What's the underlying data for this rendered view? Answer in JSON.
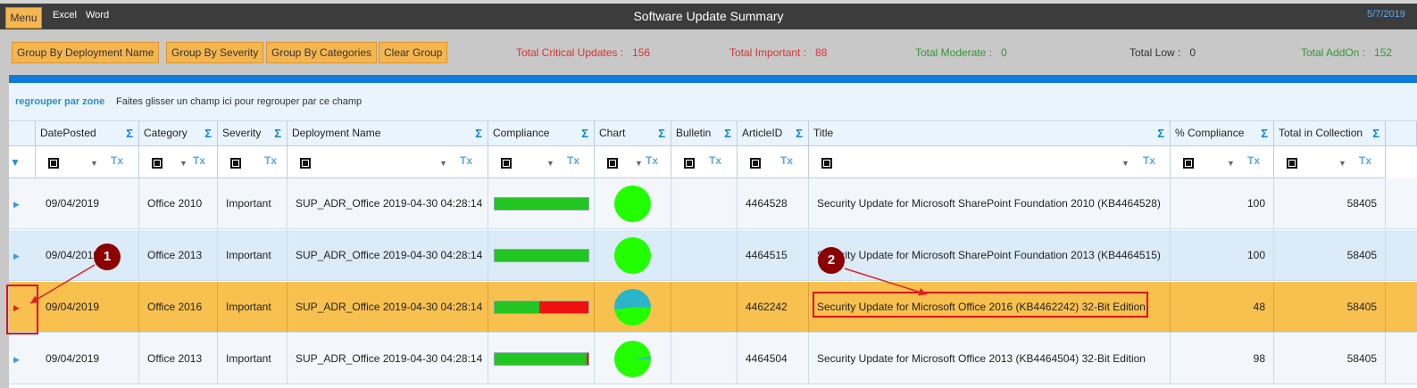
{
  "topbar": {
    "menu": "Menu",
    "excel": "Excel",
    "word": "Word",
    "title": "Software Update Summary",
    "date": "5/7/2019"
  },
  "toolbar": {
    "buttons": [
      "Group By Deployment Name",
      "Group By Severity",
      "Group By Categories",
      "Clear Group"
    ],
    "stats": [
      {
        "label": "Total Critical Updates :",
        "value": "156",
        "color": "#e03030"
      },
      {
        "label": "Total Important :",
        "value": "88",
        "color": "#e03030"
      },
      {
        "label": "Total Moderate :",
        "value": "0",
        "color": "#2f9a2f"
      },
      {
        "label": "Total Low :",
        "value": "0",
        "color": "#333333"
      },
      {
        "label": "Total AddOn :",
        "value": "152",
        "color": "#2f9a2f"
      }
    ]
  },
  "groupzone": {
    "title": "regrouper par zone",
    "hint": "Faites glisser un champ ici pour regrouper par ce champ"
  },
  "columns": [
    "DatePosted",
    "Category",
    "Severity",
    "Deployment Name",
    "Compliance",
    "Chart",
    "Bulletin",
    "ArticleID",
    "Title",
    "% Compliance",
    "Total in Collection"
  ],
  "rows": [
    {
      "date": "09/04/2019",
      "category": "Office 2010",
      "severity": "Important",
      "deployment": "SUP_ADR_Office 2019-04-30 04:28:14",
      "bulletin": "",
      "article": "4464528",
      "title": "Security Update for Microsoft SharePoint Foundation 2010 (KB4464528)",
      "compliance": "100",
      "total": "58405",
      "pct": 100,
      "chart_secondary": "#22ff00"
    },
    {
      "date": "09/04/2019",
      "category": "Office 2013",
      "severity": "Important",
      "deployment": "SUP_ADR_Office 2019-04-30 04:28:14",
      "bulletin": "",
      "article": "4464515",
      "title": "Security Update for Microsoft SharePoint Foundation 2013 (KB4464515)",
      "compliance": "100",
      "total": "58405",
      "pct": 100,
      "chart_secondary": "#22ff00"
    },
    {
      "date": "09/04/2019",
      "category": "Office 2016",
      "severity": "Important",
      "deployment": "SUP_ADR_Office 2019-04-30 04:28:14",
      "bulletin": "",
      "article": "4462242",
      "title": "Security Update for Microsoft Office 2016 (KB4462242) 32-Bit Edition",
      "compliance": "48",
      "total": "58405",
      "pct": 48,
      "chart_secondary": "#2bb5c8"
    },
    {
      "date": "09/04/2019",
      "category": "Office 2013",
      "severity": "Important",
      "deployment": "SUP_ADR_Office 2019-04-30 04:28:14",
      "bulletin": "",
      "article": "4464504",
      "title": "Security Update for Microsoft Office 2013 (KB4464504) 32-Bit Edition",
      "compliance": "98",
      "total": "58405",
      "pct": 98,
      "chart_secondary": "#2bb5c8"
    }
  ],
  "annotations": {
    "one": "1",
    "two": "2"
  },
  "colors": {
    "accent": "#f5b650",
    "selected_row": "#f8c14f",
    "grid_blue": "#0c7bdc",
    "compliant": "#22c522",
    "noncompliant": "#ee1111"
  }
}
